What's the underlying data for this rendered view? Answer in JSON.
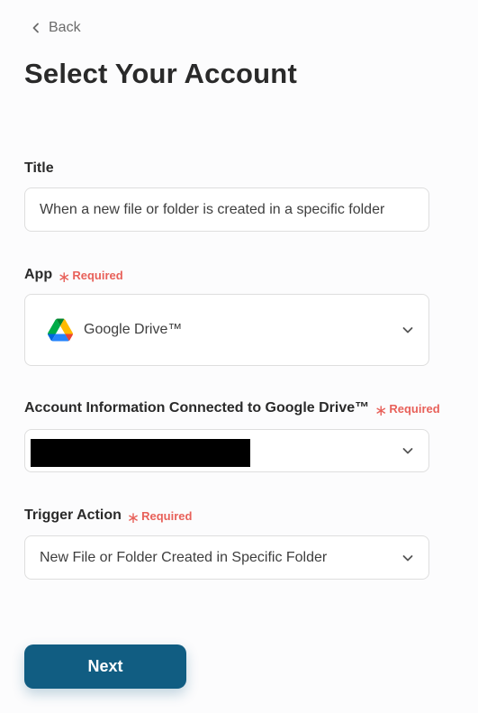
{
  "nav": {
    "back_label": "Back"
  },
  "page_title": "Select Your Account",
  "fields": {
    "title": {
      "label": "Title",
      "value": "When a new file or folder is created in a specific folder"
    },
    "app": {
      "label": "App",
      "required": "Required",
      "value": "Google Drive™",
      "icon": "google-drive-icon"
    },
    "account": {
      "label": "Account Information Connected to Google Drive™",
      "required": "Required",
      "value_redacted": true
    },
    "trigger": {
      "label": "Trigger Action",
      "required": "Required",
      "value": "New File or Folder Created in Specific Folder"
    }
  },
  "next_label": "Next",
  "colors": {
    "primary": "#115d82",
    "required": "#e8615a",
    "border": "#dedede",
    "background": "#fcfcfd"
  }
}
